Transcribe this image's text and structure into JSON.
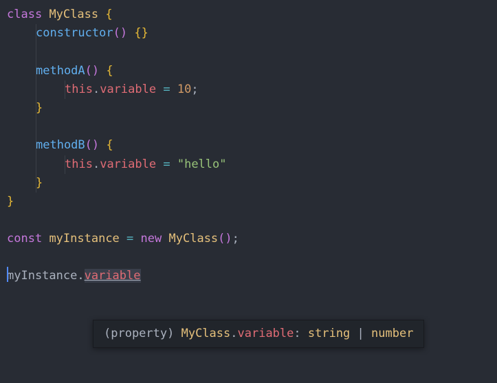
{
  "code": {
    "kw_class": "class",
    "class_name": "MyClass",
    "ctor": "constructor",
    "methodA": "methodA",
    "methodB": "methodB",
    "this": "this",
    "variable": "variable",
    "num_val": "10",
    "str_val": "\"hello\"",
    "kw_const": "const",
    "instance": "myInstance",
    "kw_new": "new"
  },
  "hover": {
    "prefix": "(property) ",
    "class": "MyClass",
    "dot": ".",
    "prop": "variable",
    "colon": ": ",
    "t1": "string",
    "pipe": " | ",
    "t2": "number"
  }
}
